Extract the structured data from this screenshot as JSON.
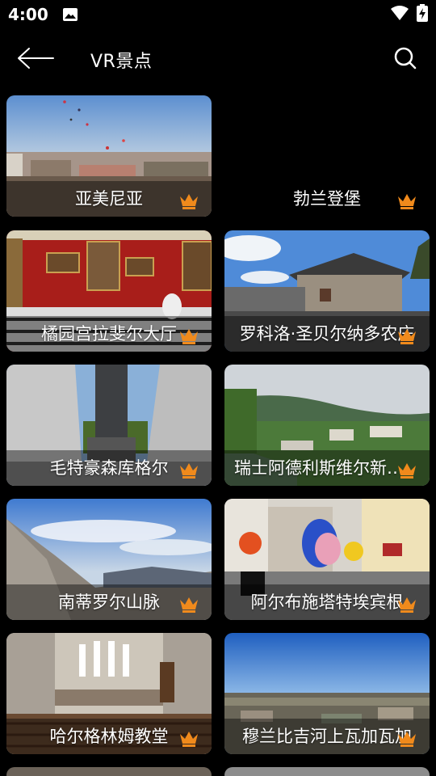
{
  "status_bar": {
    "time": "4:00",
    "icons": [
      "image-icon",
      "wifi-icon",
      "battery-charging-icon"
    ]
  },
  "app_bar": {
    "title": "VR景点",
    "back_icon": "arrow-left-icon",
    "search_icon": "search-icon"
  },
  "accent_color": "#f08a1c",
  "badge_icon": "crown-icon",
  "spots": [
    {
      "title": "亚美尼亚",
      "has_image": true
    },
    {
      "title": "勃兰登堡",
      "has_image": false
    },
    {
      "title": "橘园宫拉斐尔大厅",
      "has_image": true
    },
    {
      "title": "罗科洛·圣贝尔纳多农庄",
      "has_image": true
    },
    {
      "title": "毛特豪森库格尔",
      "has_image": true
    },
    {
      "title": "瑞士阿德利斯维尔新教...",
      "has_image": true
    },
    {
      "title": "南蒂罗尔山脉",
      "has_image": true
    },
    {
      "title": "阿尔布施塔特埃宾根",
      "has_image": true
    },
    {
      "title": "哈尔格林姆教堂",
      "has_image": true
    },
    {
      "title": "穆兰比吉河上瓦加瓦加",
      "has_image": true
    }
  ]
}
